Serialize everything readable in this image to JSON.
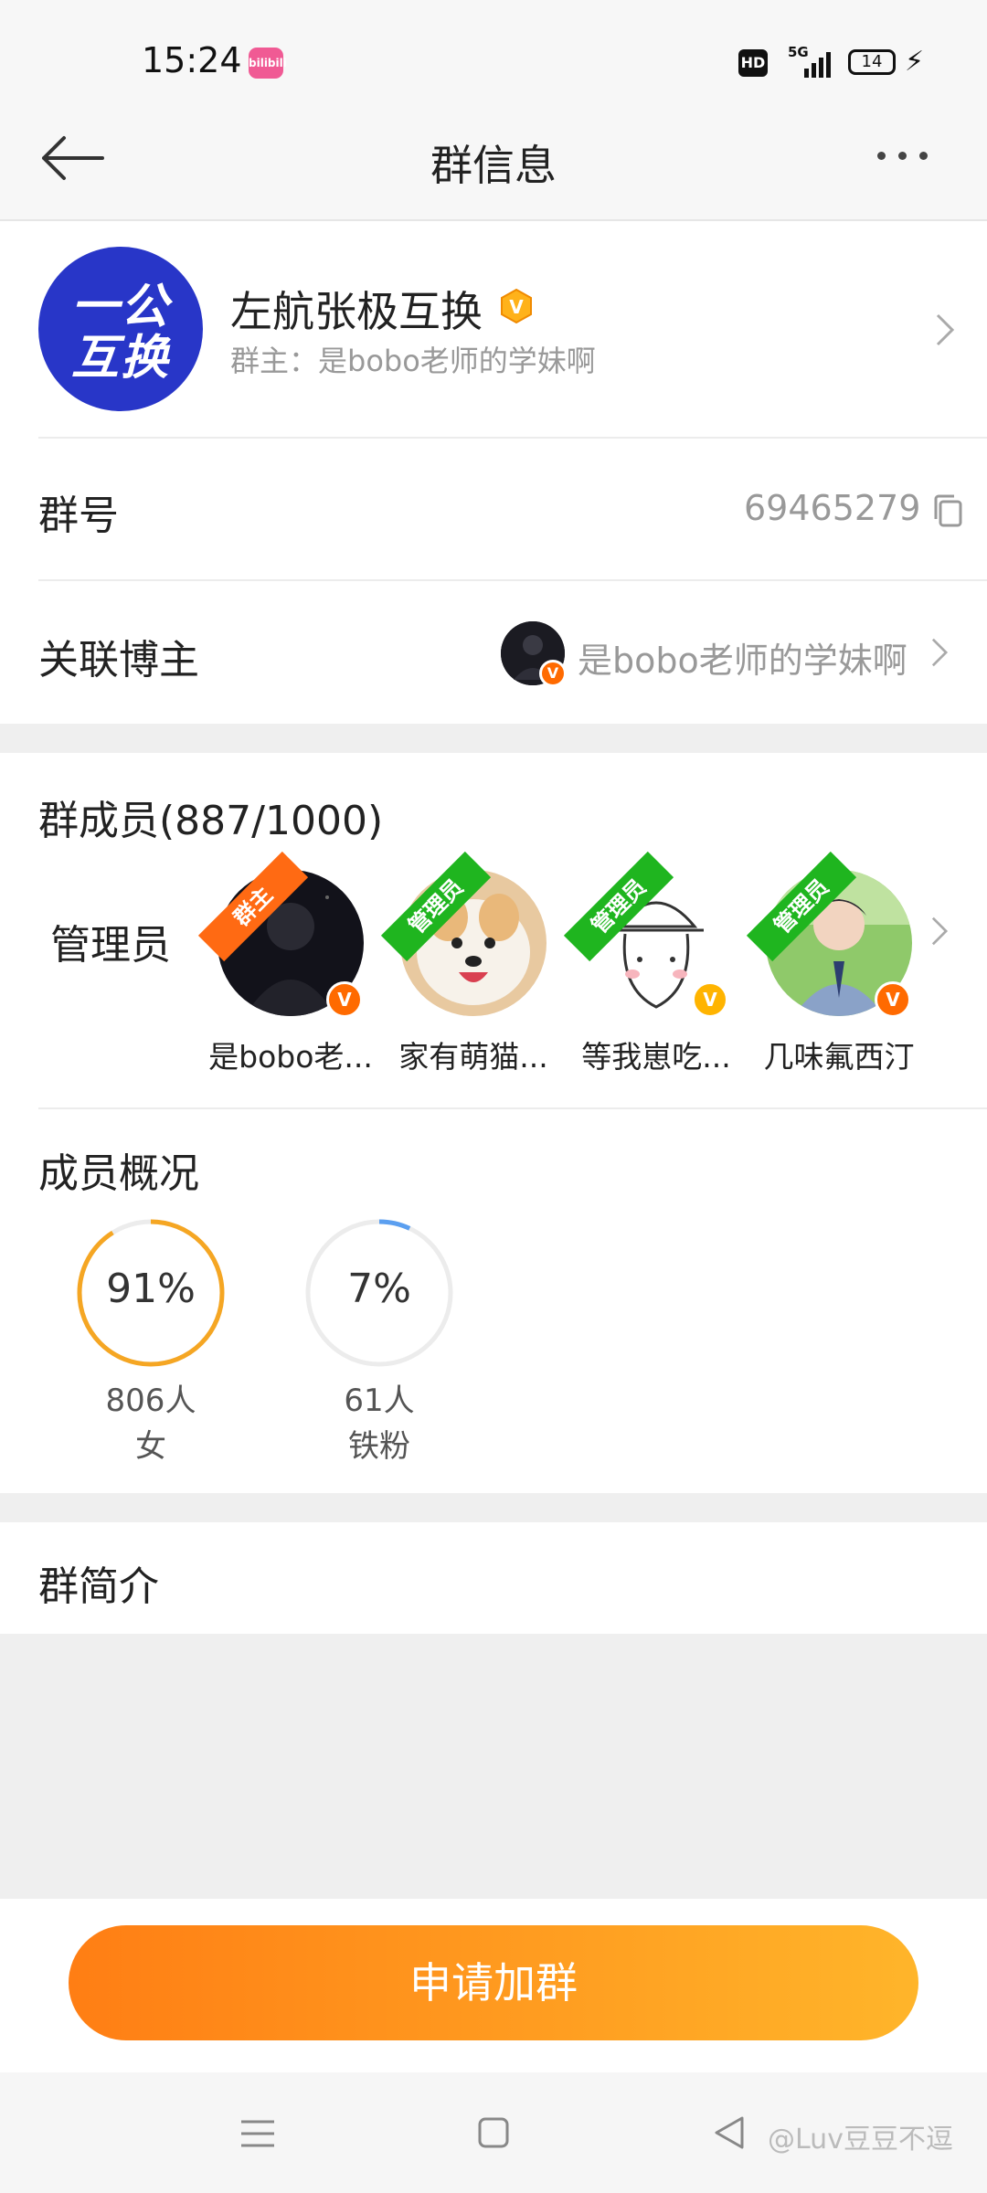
{
  "status_bar": {
    "time": "15:24",
    "app_badge": "bilibili",
    "hd": "HD",
    "network": "5G",
    "battery": "14"
  },
  "nav": {
    "title": "群信息"
  },
  "group": {
    "avatar_text_line1": "一公",
    "avatar_text_line2": "互换",
    "name": "左航张极互换",
    "owner": "群主：是bobo老师的学妹啊"
  },
  "info_rows": {
    "group_id_label": "群号",
    "group_id_value": "69465279",
    "blogger_label": "关联博主",
    "blogger_name": "是bobo老师的学妹啊"
  },
  "members": {
    "title": "群成员(887/1000)",
    "admins_label": "管理员",
    "admins": [
      {
        "ribbon": "群主",
        "name": "是bobo老...",
        "badge_color": "#ff6a00"
      },
      {
        "ribbon": "管理员",
        "name": "家有萌猫...",
        "badge_color": ""
      },
      {
        "ribbon": "管理员",
        "name": "等我崽吃...",
        "badge_color": "#ffb400"
      },
      {
        "ribbon": "管理员",
        "name": "几味氟西汀",
        "badge_color": "#ff6a00"
      }
    ],
    "verified_mark": "V"
  },
  "overview": {
    "title": "成员概况",
    "stats": [
      {
        "percent": "91%",
        "fraction": 0.91,
        "count": "806人",
        "label": "女",
        "color": "#f5a623"
      },
      {
        "percent": "7%",
        "fraction": 0.07,
        "count": "61人",
        "label": "铁粉",
        "color": "#5b9ff0"
      }
    ]
  },
  "intro": {
    "title": "群简介"
  },
  "cta": {
    "label": "申请加群"
  },
  "watermark": "@Luv豆豆不逗",
  "colors": {
    "accent_orange": "#ff8a1e",
    "ribbon_owner": "#ff6a13",
    "ribbon_admin": "#1fb51f",
    "group_avatar_bg": "#2836c8"
  }
}
